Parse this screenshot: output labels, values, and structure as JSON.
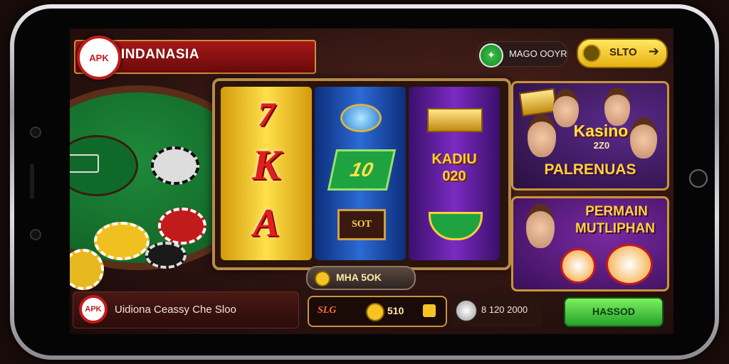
{
  "header": {
    "brand_logo_text": "APK",
    "brand_title": "INDANASIA",
    "user_name": "MAGO OOYR",
    "slto_label": "SLTO"
  },
  "reels": {
    "reel1_top": "7",
    "reel1_mid": "K",
    "reel1_bot": "A",
    "reel2_badge": "10",
    "reel2_slot": "SOT",
    "reel3_title": "KADIU",
    "reel3_sub": "020",
    "win_label": "MHA 5OK"
  },
  "promos": {
    "kasino_title": "Kasino",
    "kasino_sub": "2Z0",
    "paln_title": "PALRENUAS",
    "permain_line1": "PERMAIN",
    "permain_line2": "MUTLIPHAN"
  },
  "bottom": {
    "apk_text": "APK",
    "description": "Uidiona Ceassy Che Sloo",
    "bet_label": "SLG",
    "bet_value": "510",
    "jackpot_value": "8 120 2000",
    "cta_label": "HASSOD"
  },
  "colors": {
    "accent_red": "#c21b1b",
    "gold": "#f5c323",
    "green": "#25a12a"
  }
}
